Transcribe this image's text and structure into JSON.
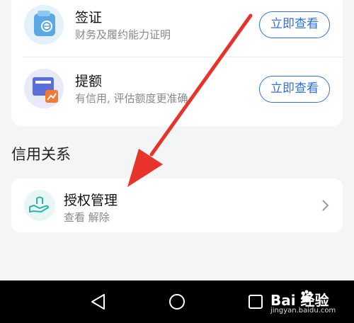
{
  "products": [
    {
      "title": "签证",
      "subtitle": "财务及履约能力证明",
      "button": "立即查看",
      "icon": "visa-card-icon"
    },
    {
      "title": "提额",
      "subtitle": "有信用, 评估额度更准确",
      "button": "立即查看",
      "icon": "limit-raise-chart-icon"
    }
  ],
  "credit_relations": {
    "section_title": "信用关系",
    "authorization": {
      "title": "授权管理",
      "subtitle": "查看 解除",
      "icon": "hand-authorization-icon"
    }
  },
  "navigation_bar": {
    "back": "triangle-back-icon",
    "home": "circle-home-icon",
    "recent": "square-recent-icon"
  },
  "watermark": {
    "logo_text": "Bai 经验",
    "url": "jingyan.baidu.com"
  },
  "colors": {
    "accent": "#2f6fe0",
    "annotation_arrow": "#e8332a"
  }
}
